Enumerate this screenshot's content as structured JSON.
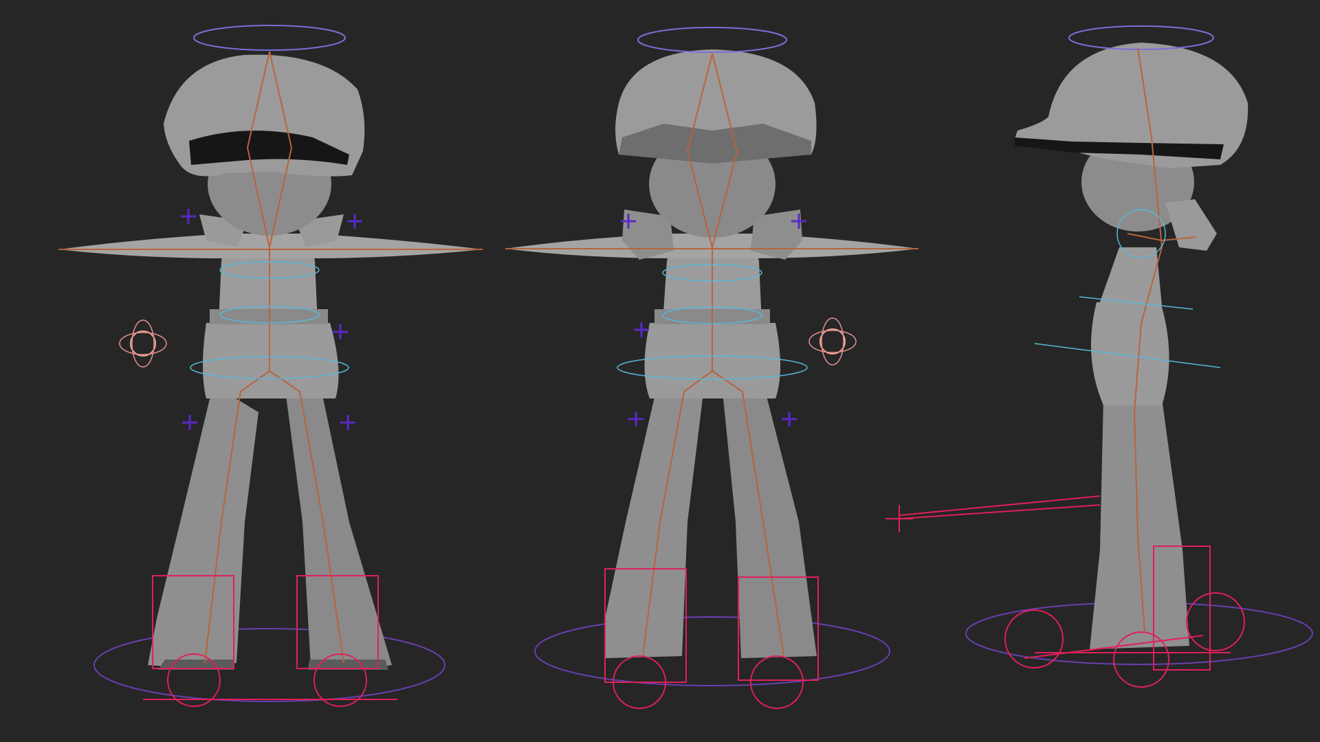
{
  "viewport": {
    "background": "#262626",
    "views": [
      "front",
      "back",
      "side"
    ]
  },
  "colors": {
    "mesh_light": "#9a9a9a",
    "mesh_mid": "#7a7a7a",
    "mesh_dark": "#5b5b5b",
    "shadow": "#151515",
    "bone": "#b8643c",
    "ik_handle": "#e0205a",
    "foot_circle": "#6a3fb0",
    "halo": "#7a6fd8",
    "spine_ring": "#59b8d8",
    "pole_vector": "#5a28c8",
    "eye_control": "#f0a890"
  },
  "icons": {
    "pole_vector": "cross-icon",
    "eye_control": "flower-locator-icon"
  }
}
